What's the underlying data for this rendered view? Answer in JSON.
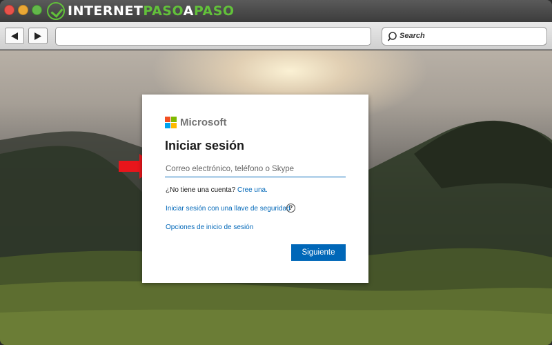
{
  "brand": {
    "part1": "INTERNET",
    "part2": "PASO",
    "part3": "A",
    "part4": "PASO"
  },
  "browser": {
    "back_icon": "back-arrow-icon",
    "forward_icon": "forward-arrow-icon",
    "url": "",
    "search_placeholder": "Search"
  },
  "login": {
    "brand_name": "Microsoft",
    "heading": "Iniciar sesión",
    "email_placeholder": "Correo electrónico, teléfono o Skype",
    "no_account_text": "¿No tiene una cuenta?",
    "create_link": "Cree una.",
    "security_key_link": "Iniciar sesión con una llave de seguridad",
    "help_icon_glyph": "?",
    "options_link": "Opciones de inicio de sesión",
    "next_button": "Siguiente"
  },
  "colors": {
    "accent_blue": "#0067b8",
    "annotation_arrow": "#e8151b",
    "brand_green": "#62c13a"
  }
}
